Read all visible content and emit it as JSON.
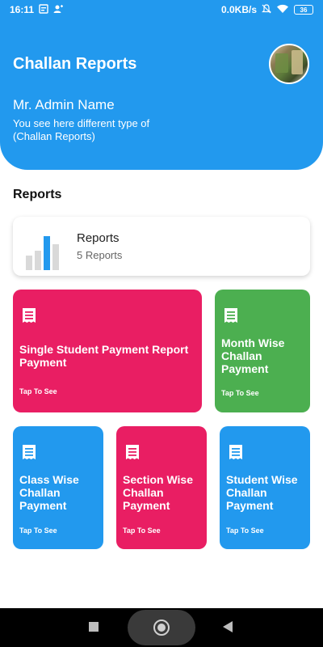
{
  "status_bar": {
    "time": "16:11",
    "network_speed": "0.0KB/s",
    "battery": "36"
  },
  "header": {
    "title": "Challan Reports",
    "admin_name": "Mr. Admin Name",
    "subtitle": "You see here different type  of\n (Challan Reports)",
    "color": "#2299EE"
  },
  "section": {
    "title": "Reports"
  },
  "summary": {
    "label": "Reports",
    "count": "5 Reports",
    "icon": "bar-chart-icon"
  },
  "tiles": [
    {
      "title": "Single Student Payment Report Payment",
      "action": "Tap To See",
      "color": "#E91E63",
      "icon": "receipt-icon"
    },
    {
      "title": "Month Wise Challan Payment",
      "action": "Tap To See",
      "color": "#4CAF50",
      "icon": "receipt-icon"
    },
    {
      "title": "Class Wise Challan Payment",
      "action": "Tap To See",
      "color": "#2299EE",
      "icon": "receipt-icon"
    },
    {
      "title": "Section Wise Challan Payment",
      "action": "Tap To See",
      "color": "#E91E63",
      "icon": "receipt-icon"
    },
    {
      "title": "Student Wise Challan Payment",
      "action": "Tap To See",
      "color": "#2299EE",
      "icon": "receipt-icon"
    }
  ]
}
